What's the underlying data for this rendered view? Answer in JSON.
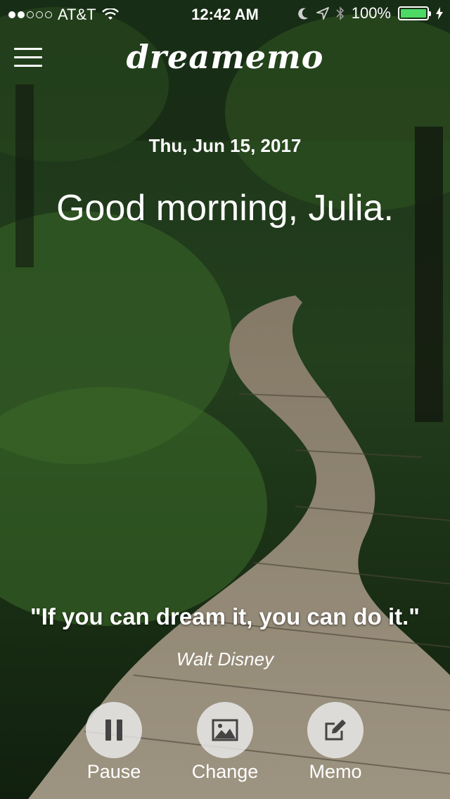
{
  "status_bar": {
    "carrier": "AT&T",
    "time": "12:42 AM",
    "battery": "100%",
    "battery_color": "#4cd964",
    "icons": [
      "signal-dots-icon",
      "wifi-icon",
      "moon-icon",
      "location-icon",
      "bluetooth-icon",
      "battery-icon",
      "charging-icon"
    ]
  },
  "header": {
    "menu_icon": "hamburger-icon",
    "logo": "dreamemo"
  },
  "main": {
    "date": "Thu, Jun 15, 2017",
    "greeting": "Good morning, Julia.",
    "quote": "\"If you can dream it, you can do it.\"",
    "author": "Walt Disney"
  },
  "actions": [
    {
      "label": "Pause",
      "icon": "pause-icon"
    },
    {
      "label": "Change",
      "icon": "image-icon"
    },
    {
      "label": "Memo",
      "icon": "edit-icon"
    }
  ],
  "colors": {
    "text": "#ffffff",
    "button_bg": "#ebebeb",
    "icon": "#444444"
  }
}
